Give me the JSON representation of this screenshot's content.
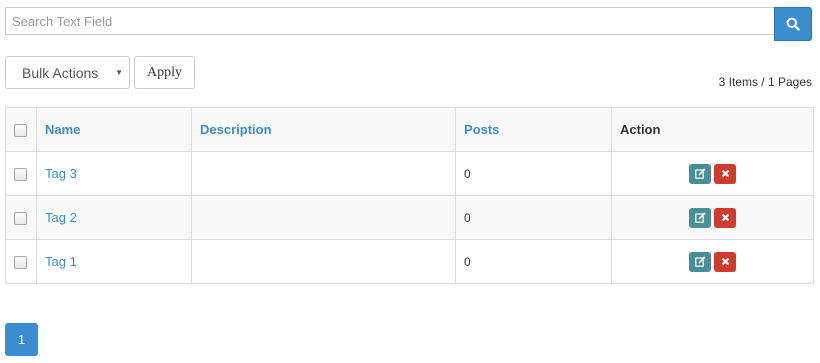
{
  "search": {
    "placeholder": "Search Text Field",
    "button_icon": "search-icon"
  },
  "bulk": {
    "select_value": "Bulk Actions",
    "apply_label": "Apply"
  },
  "items_info": "3 Items / 1 Pages",
  "table": {
    "columns": [
      "Name",
      "Description",
      "Posts",
      "Action"
    ],
    "rows": [
      {
        "name": "Tag 3",
        "description": "",
        "posts": "0"
      },
      {
        "name": "Tag 2",
        "description": "",
        "posts": "0"
      },
      {
        "name": "Tag 1",
        "description": "",
        "posts": "0"
      }
    ]
  },
  "pagination": {
    "current": "1"
  },
  "colors": {
    "accent": "#3c8dcd",
    "edit": "#4a8f97",
    "delete": "#cf3b2d"
  }
}
